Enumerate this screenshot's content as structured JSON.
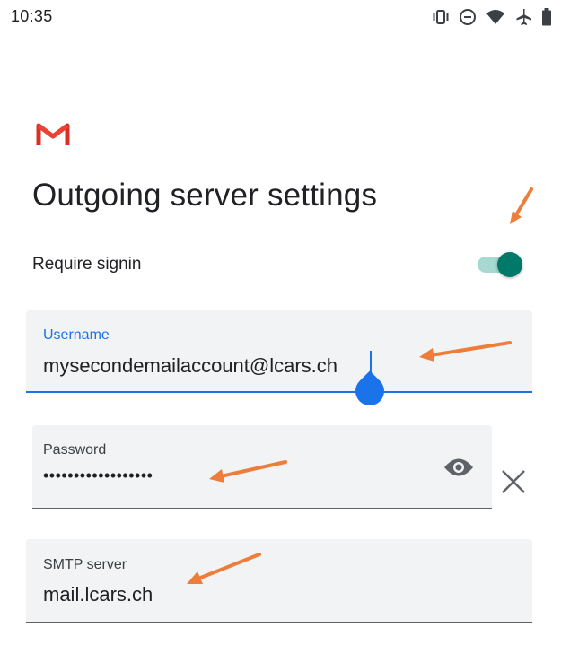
{
  "status_bar": {
    "time": "10:35",
    "icons": [
      "vibrate-icon",
      "do-not-disturb-icon",
      "wifi-icon",
      "airplane-mode-icon",
      "battery-icon"
    ]
  },
  "app": {
    "logo": "gmail-icon"
  },
  "page": {
    "title": "Outgoing server settings"
  },
  "require_signin": {
    "label": "Require signin",
    "enabled": true
  },
  "username": {
    "label": "Username",
    "value": "mysecondemailaccount@lcars.ch"
  },
  "password": {
    "label": "Password",
    "value": "••••••••••••••••••",
    "visibility_icon": "eye-icon",
    "clear_icon": "close-icon"
  },
  "smtp_server": {
    "label": "SMTP server",
    "value": "mail.lcars.ch"
  },
  "colors": {
    "accent": "#1a73e8",
    "toggle_on": "#00796b",
    "toggle_track": "#a7d9d2",
    "gmail_red": "#d93025",
    "annotation": "#ee7d3b"
  }
}
